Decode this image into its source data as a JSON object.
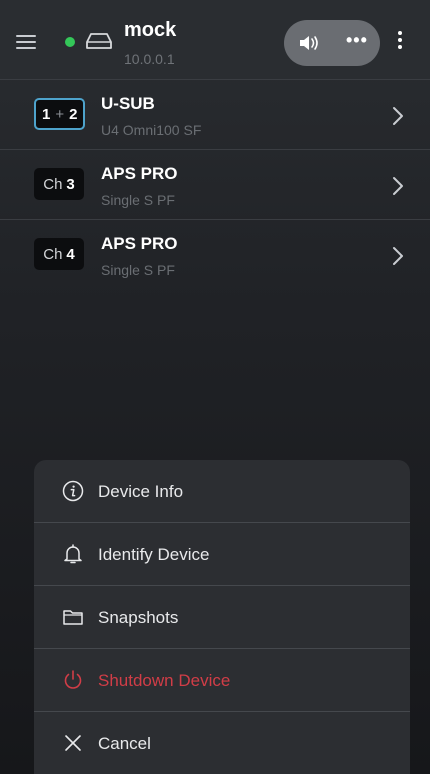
{
  "header": {
    "device_name": "mock",
    "device_ip": "10.0.0.1",
    "status_color": "#34c759",
    "more_dots": "•••"
  },
  "channels": [
    {
      "badge_first": "1",
      "badge_sep": "+",
      "badge_second": "2",
      "title": "U-SUB",
      "subtitle": "U4 Omni100 SF"
    },
    {
      "badge_prefix": "Ch",
      "badge_number": "3",
      "title": "APS PRO",
      "subtitle": "Single S PF"
    },
    {
      "badge_prefix": "Ch",
      "badge_number": "4",
      "title": "APS PRO",
      "subtitle": "Single S PF"
    }
  ],
  "action_sheet": {
    "items": [
      {
        "label": "Device Info",
        "icon": "info-icon"
      },
      {
        "label": "Identify Device",
        "icon": "bell-icon"
      },
      {
        "label": "Snapshots",
        "icon": "folder-icon"
      },
      {
        "label": "Shutdown Device",
        "icon": "power-icon"
      },
      {
        "label": "Cancel",
        "icon": "close-icon"
      }
    ]
  },
  "colors": {
    "accent": "#4ea3cc",
    "danger": "#d13d47"
  }
}
